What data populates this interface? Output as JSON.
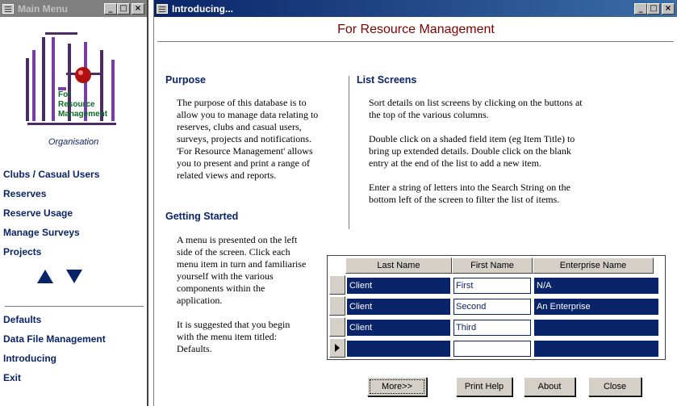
{
  "main_menu": {
    "title": "Main Menu",
    "logo_text": [
      "For",
      "Resource",
      "Management"
    ],
    "org_label": "Organisation",
    "items": [
      "Clubs / Casual Users",
      "Reserves",
      "Reserve Usage",
      "Manage Surveys",
      "Projects"
    ],
    "items2": [
      "Defaults",
      "Data File Management",
      "Introducing",
      "Exit"
    ]
  },
  "intro": {
    "title": "Introducing...",
    "main_title": "For Resource Management",
    "purpose": {
      "heading": "Purpose",
      "lines": [
        "The purpose of this database is to",
        "allow you to manage data relating to",
        "reserves, clubs and casual users,",
        "surveys, projects and notifications.",
        "'For Resource Management' allows",
        "you to present and print a range of",
        "related views and reports."
      ]
    },
    "getting_started": {
      "heading": "Getting Started",
      "lines": [
        "A menu is presented on the left",
        "side of the screen.  Click each",
        "menu item in turn and familiarise",
        "yourself with the various",
        "components within the",
        "application.",
        "",
        "It is suggested that you begin",
        "with the menu item titled:",
        "Defaults."
      ]
    },
    "list_screens": {
      "heading": "List Screens",
      "lines": [
        "Sort details on list screens by clicking on the buttons at",
        "the top of the various columns.",
        "",
        "Double click on a shaded field item (eg Item Title) to",
        "bring up extended details.  Double click on the blank",
        "entry at the end of the list to add a new item.",
        "",
        "Enter a string of letters into the Search String on the",
        "bottom left of the screen to filter the list of items."
      ]
    },
    "grid": {
      "columns": [
        "Last Name",
        "First Name",
        "Enterprise Name"
      ],
      "rows": [
        [
          "Client",
          "First",
          "N/A"
        ],
        [
          "Client",
          "Second",
          "An Enterprise"
        ],
        [
          "Client",
          "Third",
          ""
        ],
        [
          "",
          "",
          ""
        ]
      ]
    },
    "buttons": {
      "more": "More>>",
      "print_help": "Print Help",
      "about": "About",
      "close": "Close"
    }
  },
  "window_controls": {
    "minimize": "_",
    "maximize": "□",
    "close": "×"
  },
  "colors": {
    "accent": "#0a246a",
    "title": "#800000"
  }
}
